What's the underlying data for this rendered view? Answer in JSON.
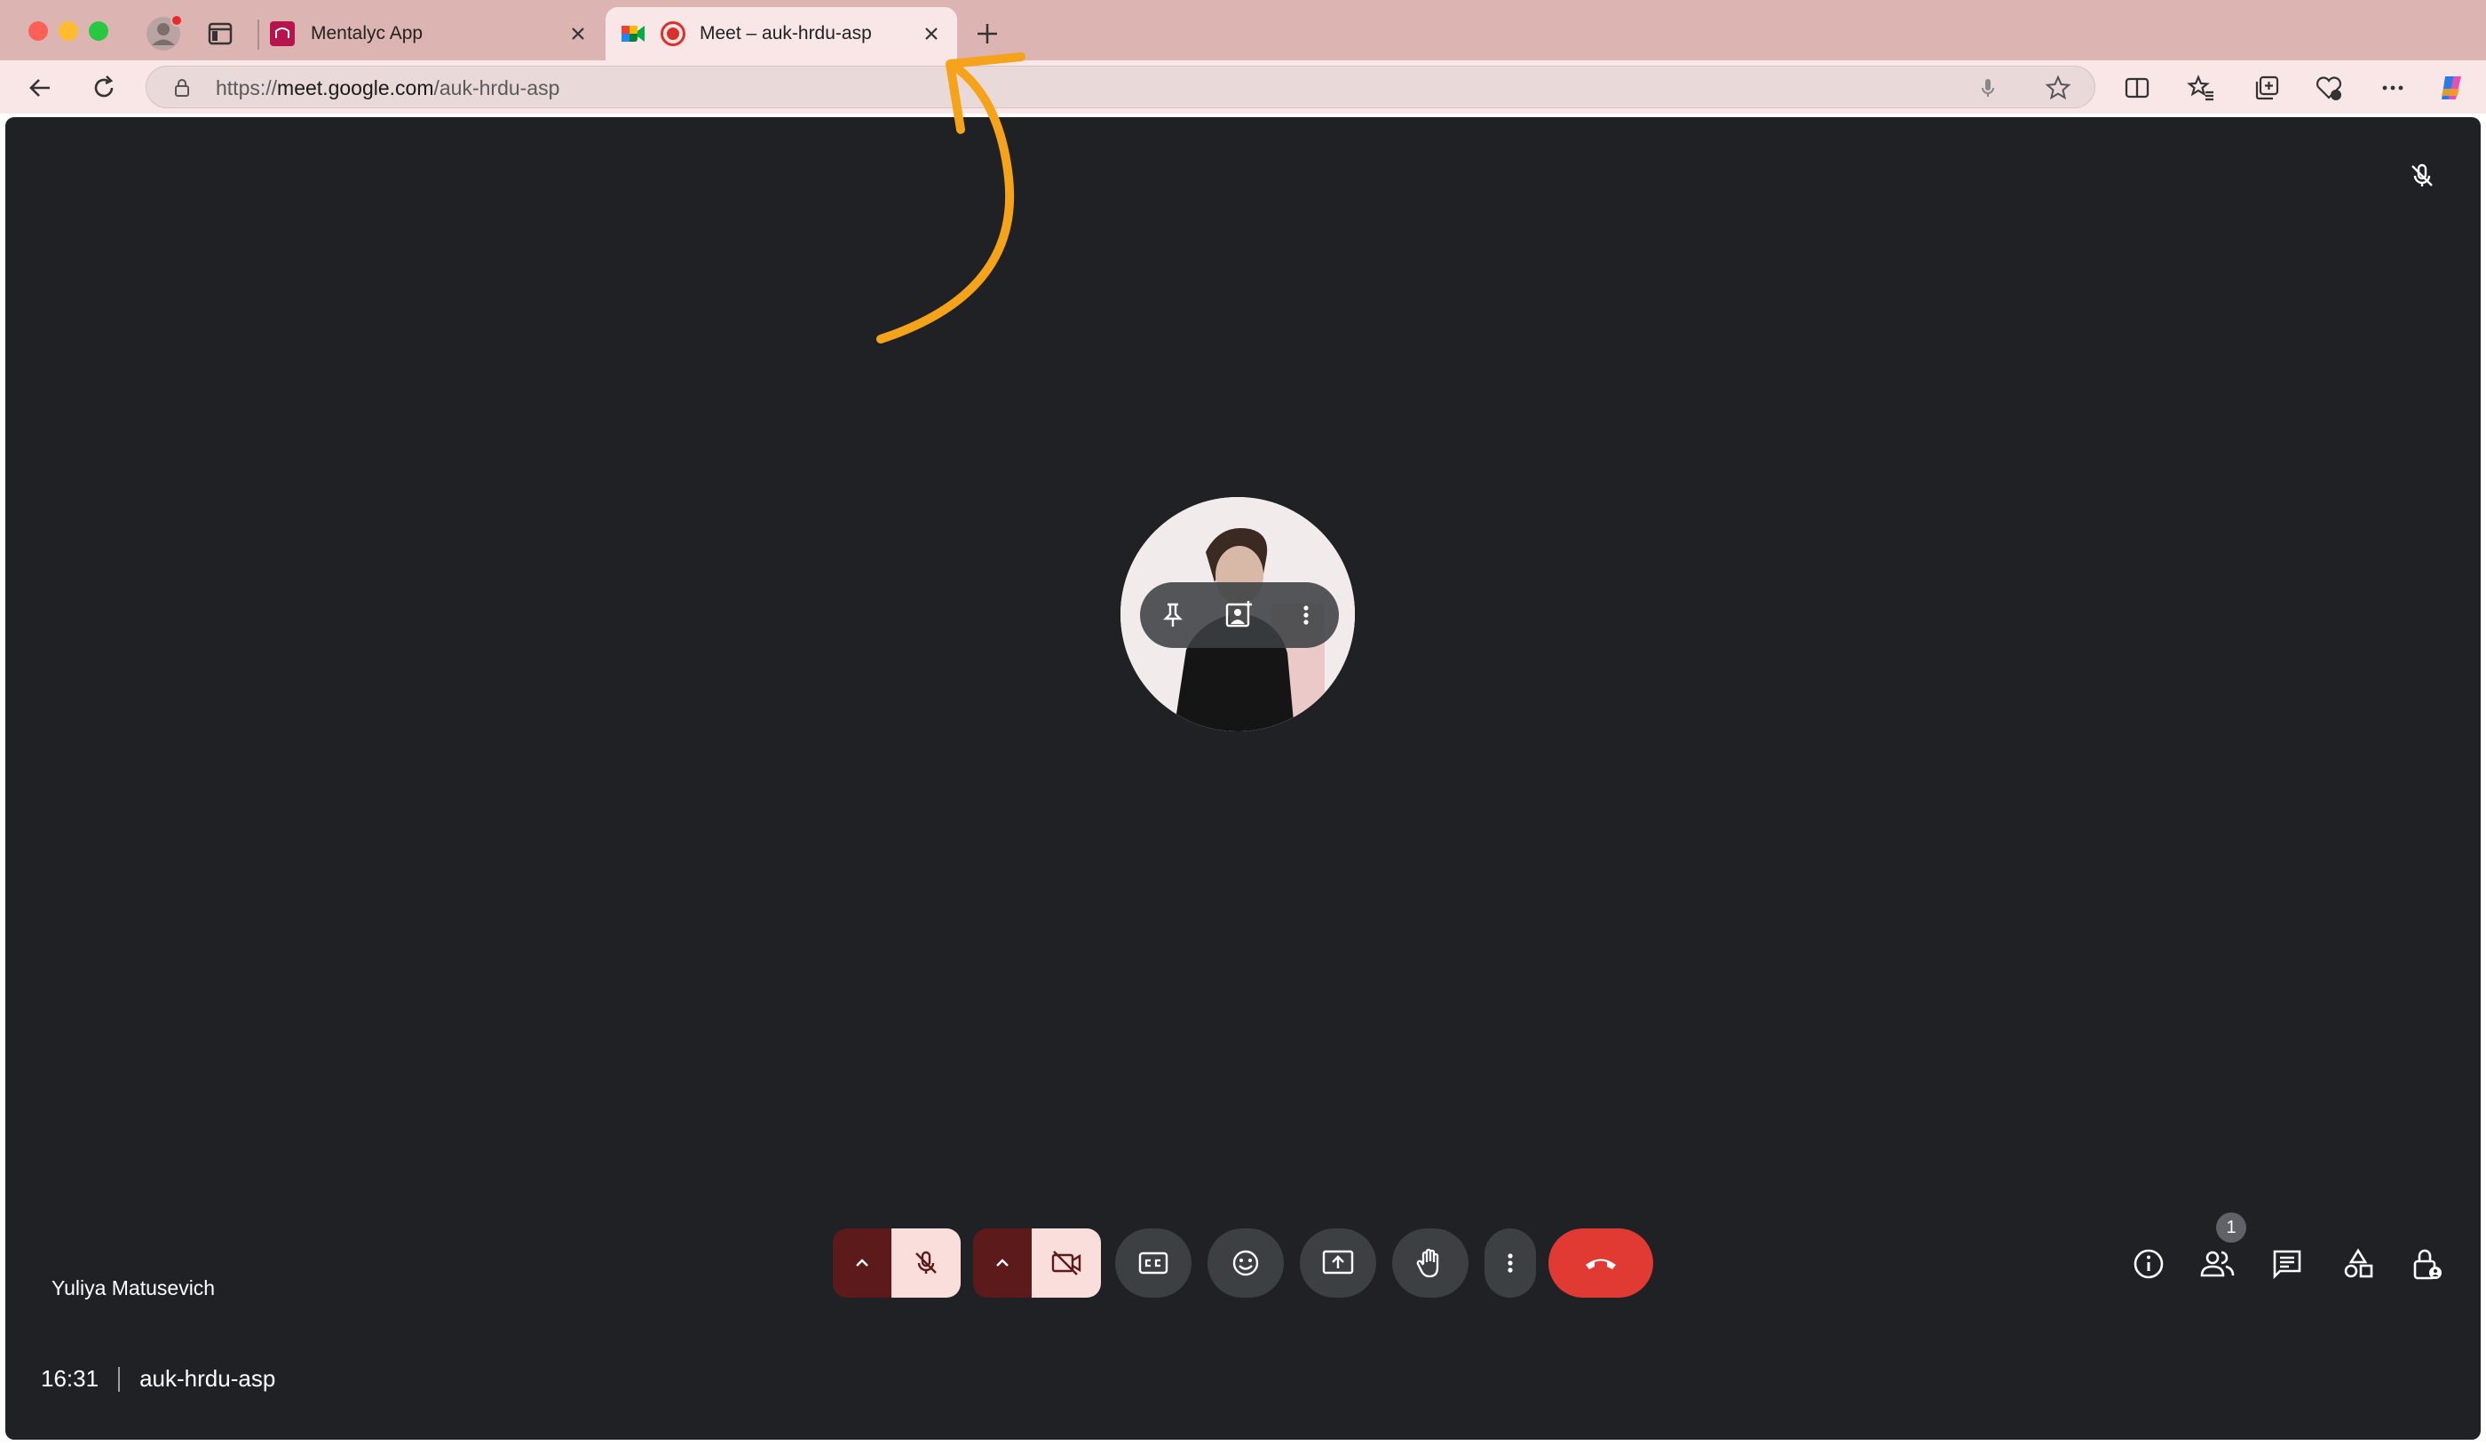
{
  "browser": {
    "tabs": [
      {
        "label": "Mentalyc App"
      },
      {
        "label": "Meet – auk-hrdu-asp"
      }
    ],
    "address": {
      "protocol": "https://",
      "host": "meet.google.com",
      "path": "/auk-hrdu-asp"
    }
  },
  "meet": {
    "participant_name": "Yuliya Matusevich",
    "time": "16:31",
    "meeting_code": "auk-hrdu-asp",
    "people_count": "1"
  },
  "colors": {
    "tabbar": "#dcb4b1",
    "meet_bg": "#202124",
    "hangup": "#e03a33",
    "arrow": "#f5a31a"
  }
}
